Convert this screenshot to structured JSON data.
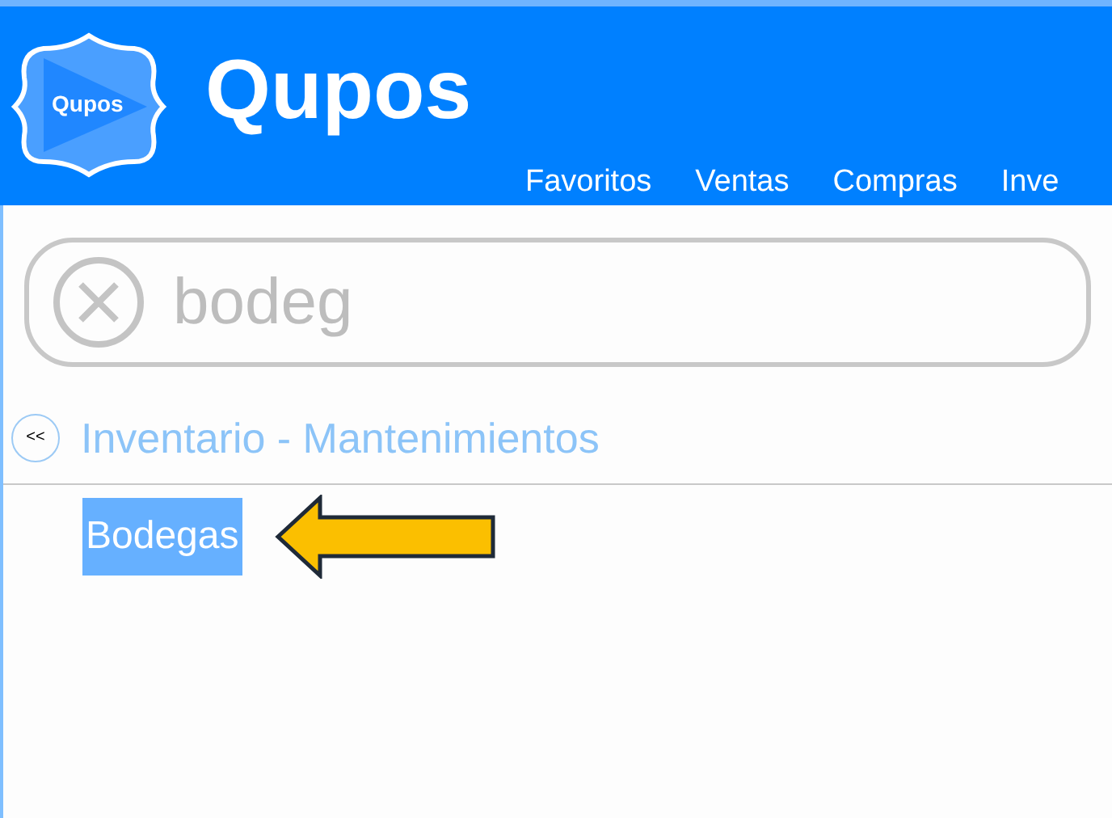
{
  "header": {
    "logo_badge": "Qupos",
    "brand": "Qupos",
    "menu": [
      {
        "label": "Favoritos"
      },
      {
        "label": "Ventas"
      },
      {
        "label": "Compras"
      },
      {
        "label": "Inve"
      }
    ]
  },
  "search": {
    "value": "bodeg"
  },
  "section": {
    "back_label": "<<",
    "title": "Inventario - Mantenimientos"
  },
  "results": [
    {
      "label": "Bodegas",
      "selected": true
    }
  ]
}
